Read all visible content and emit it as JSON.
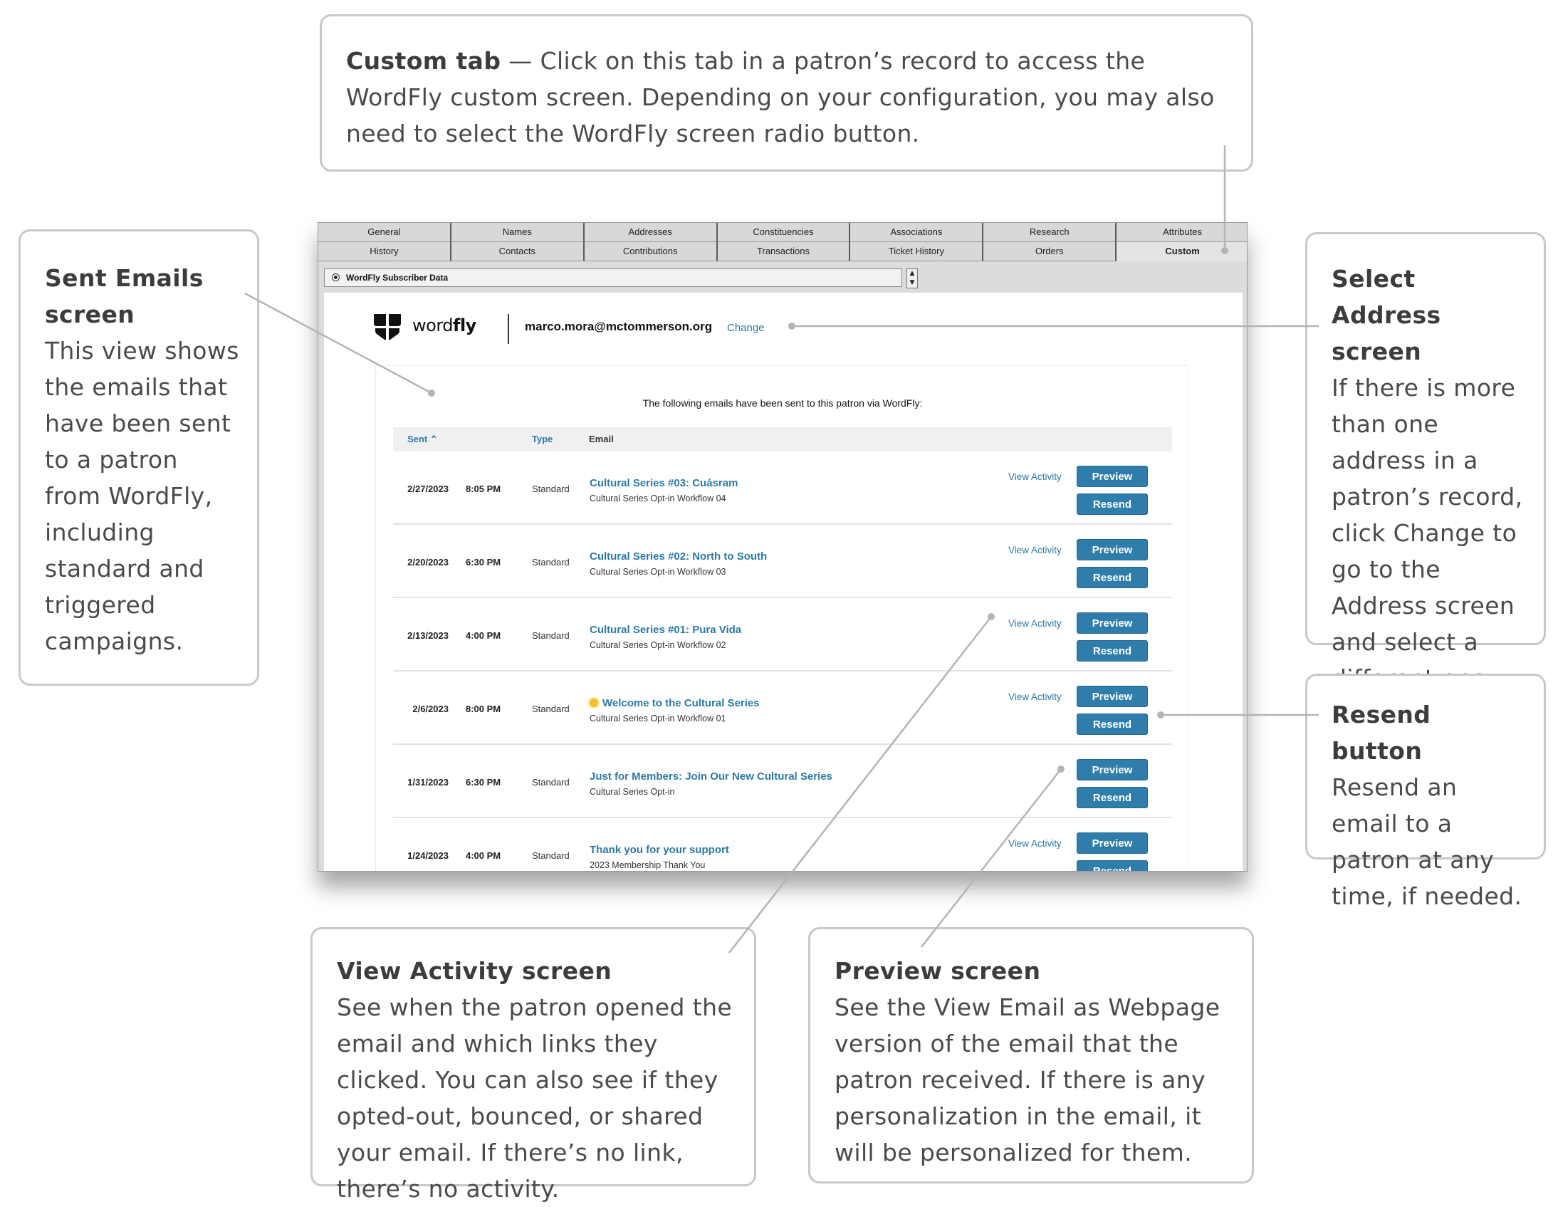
{
  "callouts": {
    "custom_tab": {
      "title": "Custom tab",
      "body": " — Click on this tab in a patron’s record to access the WordFly custom screen. Depending on your configuration, you may also need to select the WordFly screen radio button."
    },
    "sent_emails": {
      "title": "Sent Emails screen",
      "body": "This view shows the emails that have been sent to a patron from WordFly, including standard and triggered campaigns."
    },
    "select_address": {
      "title": "Select Address screen",
      "body": "If there is more than one address in a patron’s record, click Change to go to the Address screen and select a different one."
    },
    "resend_button": {
      "title": "Resend button",
      "body": "Resend an email to a patron at any time, if needed."
    },
    "view_activity": {
      "title": "View Activity screen",
      "body": "See when the patron opened the email and which links they clicked. You can also see if they opted-out, bounced, or shared your email. If there’s no link, there’s no activity."
    },
    "preview": {
      "title": "Preview screen",
      "body": "See the View Email as Webpage version of the email that the patron received. If there is any personalization in the email, it will be personalized for them."
    }
  },
  "tabs": {
    "row1": [
      "General",
      "Names",
      "Addresses",
      "Constituencies",
      "Associations",
      "Research",
      "Attributes"
    ],
    "row2": [
      "History",
      "Contacts",
      "Contributions",
      "Transactions",
      "Ticket History",
      "Orders",
      "Custom"
    ],
    "active": "Custom"
  },
  "radio": {
    "label": "WordFly Subscriber Data",
    "selected": true
  },
  "header": {
    "logo_text_light": "word",
    "logo_text_bold": "fly",
    "email": "marco.mora@mctommerson.org",
    "change_label": "Change"
  },
  "table": {
    "intro": "The following emails have been sent to this patron via WordFly:",
    "columns": {
      "sent": "Sent ⌃",
      "type": "Type",
      "email": "Email"
    },
    "view_activity_label": "View Activity",
    "preview_label": "Preview",
    "resend_label": "Resend",
    "rows": [
      {
        "date": "2/27/2023",
        "time": "8:05 PM",
        "type": "Standard",
        "title": "Cultural Series #03: Cuásram",
        "subtitle": "Cultural Series Opt-in Workflow 04",
        "has_activity": true,
        "icon": ""
      },
      {
        "date": "2/20/2023",
        "time": "6:30 PM",
        "type": "Standard",
        "title": "Cultural Series #02: North to South",
        "subtitle": "Cultural Series Opt-in Workflow 03",
        "has_activity": true,
        "icon": ""
      },
      {
        "date": "2/13/2023",
        "time": "4:00 PM",
        "type": "Standard",
        "title": "Cultural Series #01: Pura Vida",
        "subtitle": "Cultural Series Opt-in Workflow 02",
        "has_activity": true,
        "icon": ""
      },
      {
        "date": "2/6/2023",
        "time": "8:00 PM",
        "type": "Standard",
        "title": "Welcome to the Cultural Series",
        "subtitle": "Cultural Series Opt-in Workflow 01",
        "has_activity": true,
        "icon": "sun-icon"
      },
      {
        "date": "1/31/2023",
        "time": "6:30 PM",
        "type": "Standard",
        "title": "Just for Members: Join Our New Cultural Series",
        "subtitle": "Cultural Series Opt-in",
        "has_activity": false,
        "icon": ""
      },
      {
        "date": "1/24/2023",
        "time": "4:00 PM",
        "type": "Standard",
        "title": "Thank you for your support",
        "subtitle": "2023 Membership Thank You",
        "has_activity": true,
        "icon": ""
      }
    ]
  },
  "colors": {
    "accent": "#2f7dab",
    "link": "#2a7aa8",
    "callout_border": "#c8c8c8",
    "leader": "#b4b4b4"
  }
}
